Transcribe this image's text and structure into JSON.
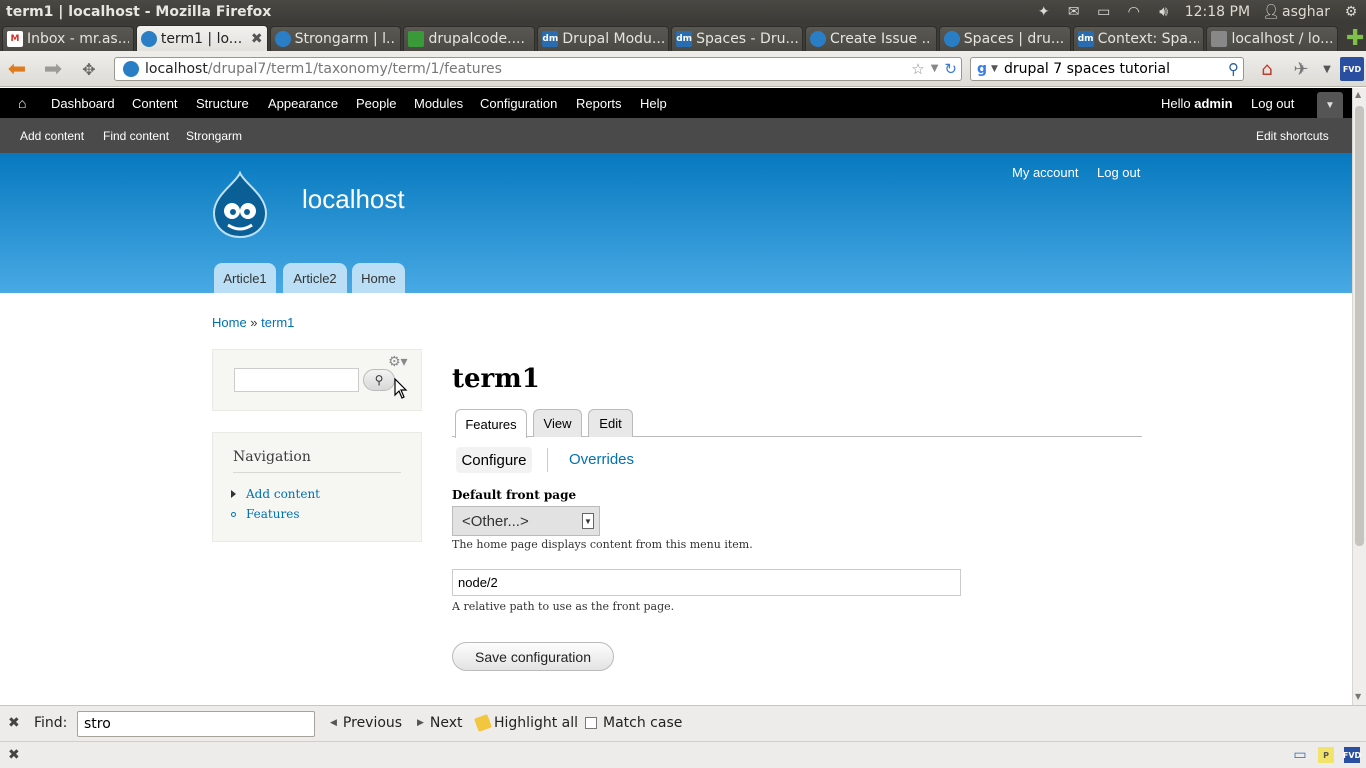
{
  "os": {
    "window_title": "term1 | localhost - Mozilla Firefox",
    "clock": "12:18 PM",
    "user": "asghar"
  },
  "tabs": [
    {
      "label": "Inbox - mr.as...",
      "icon": "gmail-icon",
      "color": "#d93025"
    },
    {
      "label": "term1 | lo...",
      "icon": "drupal-icon",
      "color": "#2a7ec6"
    },
    {
      "label": "Strongarm | l...",
      "icon": "drupal-icon",
      "color": "#2a7ec6"
    },
    {
      "label": "drupalcode....",
      "icon": "grid-icon",
      "color": "#3a9a3a"
    },
    {
      "label": "Drupal Modu...",
      "icon": "dm-icon",
      "color": "#2a6cb0"
    },
    {
      "label": "Spaces - Dru...",
      "icon": "dm-icon",
      "color": "#2a6cb0"
    },
    {
      "label": "Create Issue ...",
      "icon": "drupal-icon",
      "color": "#2a7ec6"
    },
    {
      "label": "Spaces | dru...",
      "icon": "drupal-icon",
      "color": "#2a7ec6"
    },
    {
      "label": "Context: Spa...",
      "icon": "dm-icon",
      "color": "#2a6cb0"
    },
    {
      "label": "localhost / lo...",
      "icon": "page-icon",
      "color": "#888888"
    }
  ],
  "navbar": {
    "url_host": "localhost",
    "url_path": "/drupal7/term1/taxonomy/term/1/features",
    "search_value": "drupal 7 spaces tutorial",
    "fvd_label": "FVD"
  },
  "admin_toolbar": {
    "items": [
      "Dashboard",
      "Content",
      "Structure",
      "Appearance",
      "People",
      "Modules",
      "Configuration",
      "Reports",
      "Help"
    ],
    "hello": "Hello",
    "username": "admin",
    "logout": "Log out"
  },
  "shortcuts": {
    "items": [
      "Add content",
      "Find content",
      "Strongarm"
    ],
    "edit": "Edit shortcuts"
  },
  "site": {
    "name": "localhost",
    "my_account": "My account",
    "logout": "Log out",
    "main_menu": [
      "Article1",
      "Article2",
      "Home"
    ]
  },
  "breadcrumb": {
    "home": "Home",
    "sep": " » ",
    "current": "term1"
  },
  "sidebar": {
    "navigation_title": "Navigation",
    "nav_items": [
      "Add content",
      "Features"
    ]
  },
  "page": {
    "title": "term1",
    "tabs": [
      "Features",
      "View",
      "Edit"
    ],
    "secondary_tabs": [
      "Configure",
      "Overrides"
    ],
    "front_page_label": "Default front page",
    "front_page_value": "<Other...>",
    "front_page_desc": "The home page displays content from this menu item.",
    "path_value": "node/2",
    "path_desc": "A relative path to use as the front page.",
    "save_label": "Save configuration"
  },
  "findbar": {
    "label": "Find:",
    "value": "stro",
    "previous": "Previous",
    "next": "Next",
    "highlight_all": "Highlight all",
    "match_case": "Match case"
  }
}
